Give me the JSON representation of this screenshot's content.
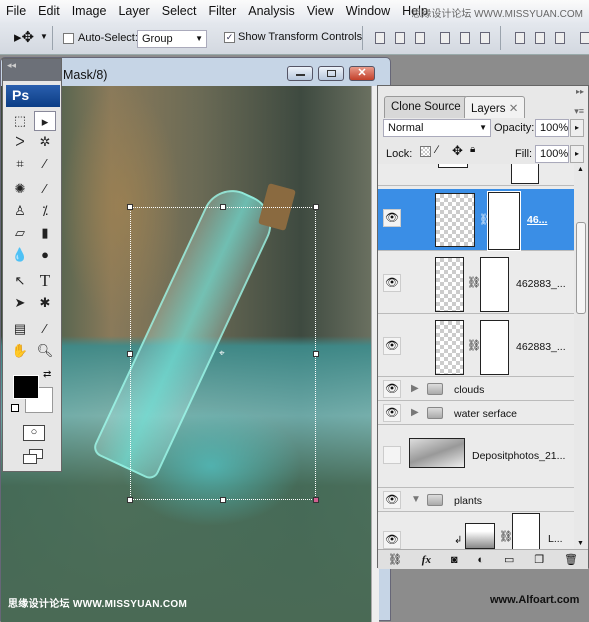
{
  "menu": [
    "File",
    "Edit",
    "Image",
    "Layer",
    "Select",
    "Filter",
    "Analysis",
    "View",
    "Window",
    "Help"
  ],
  "watermark_top": "思缘设计论坛 WWW.MISSYUAN.COM",
  "options": {
    "auto_select_label": "Auto-Select:",
    "auto_select_checked": false,
    "auto_select_value": "Group",
    "show_transform_label": "Show Transform Controls",
    "show_transform_checked": true
  },
  "document": {
    "title": "Mask/8)"
  },
  "toolbox": {
    "logo": "Ps",
    "foreground": "#000000",
    "background": "#ffffff"
  },
  "layers_panel": {
    "tabs": [
      "Clone Source",
      "Layers"
    ],
    "active_tab": "Layers",
    "blend_mode": "Normal",
    "opacity_label": "Opacity:",
    "opacity": "100%",
    "lock_label": "Lock:",
    "fill_label": "Fill:",
    "fill": "100%",
    "layers": [
      {
        "name": "46...",
        "selected": true,
        "visible": true
      },
      {
        "name": "462883_...",
        "visible": true
      },
      {
        "name": "462883_...",
        "visible": true
      },
      {
        "name": "clouds",
        "group": true,
        "visible": true
      },
      {
        "name": "water serface",
        "group": true,
        "visible": true
      },
      {
        "name": "Depositphotos_21...",
        "visible": false
      },
      {
        "name": "plants",
        "group": true,
        "expanded": true,
        "visible": true
      },
      {
        "name": "L...",
        "visible": true
      }
    ],
    "accent": "#3a8ee6"
  },
  "watermark_bottom_left": "思缘设计论坛 WWW.MISSYUAN.COM",
  "watermark_bottom_right": "www.Alfoart.com"
}
